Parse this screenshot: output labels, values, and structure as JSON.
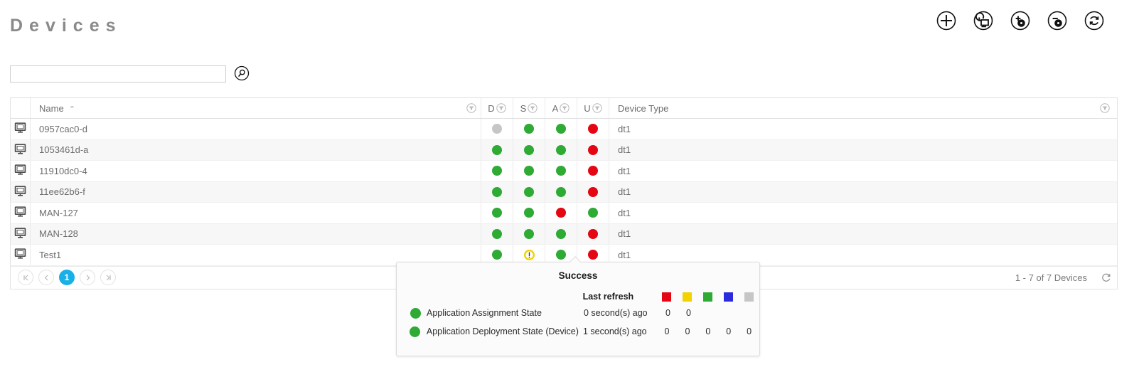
{
  "header": {
    "title": "Devices",
    "toolbar": [
      {
        "name": "add-device-button",
        "icon": "plus-circle-icon",
        "label": "Add"
      },
      {
        "name": "restore-device-button",
        "icon": "monitor-undo-circle-icon",
        "label": "Restore Device"
      },
      {
        "name": "assign-software-button",
        "icon": "disc-plus-circle-icon",
        "label": "Assign Software"
      },
      {
        "name": "unassign-software-button",
        "icon": "disc-minus-circle-icon",
        "label": "Unassign Software"
      },
      {
        "name": "refresh-button",
        "icon": "refresh-circle-icon",
        "label": "Refresh"
      }
    ]
  },
  "search": {
    "value": "",
    "placeholder": "",
    "button_label": "Search"
  },
  "table": {
    "columns": {
      "name": "Name",
      "sort_indicator": "⌃",
      "d": "D",
      "s": "S",
      "a": "A",
      "u": "U",
      "device_type": "Device Type"
    },
    "rows": [
      {
        "name": "0957cac0-d",
        "d": "gray",
        "s": "green",
        "a": "green",
        "u": "red",
        "device_type": "dt1"
      },
      {
        "name": "1053461d-a",
        "d": "green",
        "s": "green",
        "a": "green",
        "u": "red",
        "device_type": "dt1"
      },
      {
        "name": "11910dc0-4",
        "d": "green",
        "s": "green",
        "a": "green",
        "u": "red",
        "device_type": "dt1"
      },
      {
        "name": "11ee62b6-f",
        "d": "green",
        "s": "green",
        "a": "green",
        "u": "red",
        "device_type": "dt1"
      },
      {
        "name": "MAN-127",
        "d": "green",
        "s": "green",
        "a": "red",
        "u": "green",
        "device_type": "dt1"
      },
      {
        "name": "MAN-128",
        "d": "green",
        "s": "green",
        "a": "green",
        "u": "red",
        "device_type": "dt1"
      },
      {
        "name": "Test1",
        "d": "green",
        "s": "warning",
        "a": "green",
        "u": "red",
        "device_type": "dt1"
      }
    ]
  },
  "footer": {
    "pager": {
      "first": "⏪",
      "prev": "‹",
      "page": "1",
      "next": "›",
      "last": "⏩"
    },
    "count_text": "1 - 7 of 7 Devices",
    "refresh_label": "Refresh"
  },
  "popup": {
    "title": "Success",
    "last_refresh_label": "Last refresh",
    "legend_colors": [
      "#e40613",
      "#f2d200",
      "#2eaa35",
      "#2b2bdd",
      "#c6c6c6"
    ],
    "rows": [
      {
        "status": "green",
        "name": "Application Assignment State",
        "time": "0 second(s) ago",
        "counts": [
          "0",
          "0"
        ]
      },
      {
        "status": "green",
        "name": "Application Deployment State (Device)",
        "time": "1 second(s) ago",
        "counts": [
          "0",
          "0",
          "0",
          "0",
          "0"
        ]
      }
    ]
  },
  "colors": {
    "green": "#2eaa35",
    "red": "#e40613",
    "gray": "#c6c6c6",
    "yellow": "#f2d200",
    "blue": "#2b2bdd",
    "accent": "#19b0e8"
  }
}
